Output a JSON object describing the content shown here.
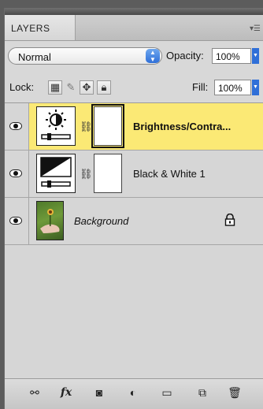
{
  "panel": {
    "tab_label": "LAYERS",
    "menu_icon": "panel-menu-icon"
  },
  "options": {
    "blend_mode": "Normal",
    "opacity_label": "Opacity:",
    "opacity_value": "100%",
    "lock_label": "Lock:",
    "fill_label": "Fill:",
    "fill_value": "100%"
  },
  "layers": [
    {
      "name": "Brightness/Contra...",
      "type": "adjustment-brightness",
      "selected": true,
      "visible": true
    },
    {
      "name": "Black & White 1",
      "type": "adjustment-bw",
      "selected": false,
      "visible": true
    },
    {
      "name": "Background",
      "type": "image",
      "selected": false,
      "visible": true,
      "locked": true
    }
  ],
  "footer": {
    "buttons": [
      "link-layers-icon",
      "fx-icon",
      "add-mask-icon",
      "new-adjustment-icon",
      "new-group-icon",
      "new-layer-icon",
      "trash-icon"
    ],
    "fx_text": "fx"
  },
  "colors": {
    "selected_row": "#fbe975",
    "accent": "#2f6fd8"
  }
}
